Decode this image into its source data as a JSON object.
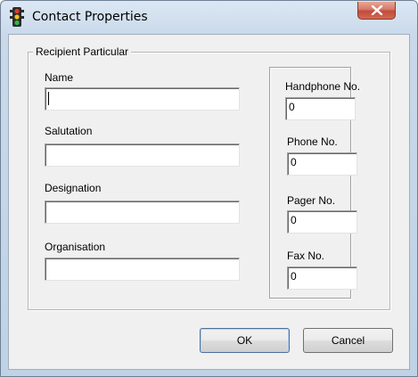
{
  "window": {
    "title": "Contact Properties"
  },
  "icons": {
    "app": "traffic-light-icon",
    "close": "close-icon"
  },
  "group": {
    "legend": "Recipient Particular"
  },
  "fields": {
    "name": {
      "label": "Name",
      "value": ""
    },
    "salutation": {
      "label": "Salutation",
      "value": ""
    },
    "designation": {
      "label": "Designation",
      "value": ""
    },
    "organisation": {
      "label": "Organisation",
      "value": ""
    },
    "handphone": {
      "label": "Handphone No.",
      "value": "0"
    },
    "phone": {
      "label": "Phone No.",
      "value": "0"
    },
    "pager": {
      "label": "Pager No.",
      "value": "0"
    },
    "fax": {
      "label": "Fax No.",
      "value": "0"
    }
  },
  "buttons": {
    "ok": "OK",
    "cancel": "Cancel"
  },
  "colors": {
    "close_button": "#c9503f",
    "dialog_bg": "#f0f0f0",
    "titlebar": "#c9d9ea"
  }
}
